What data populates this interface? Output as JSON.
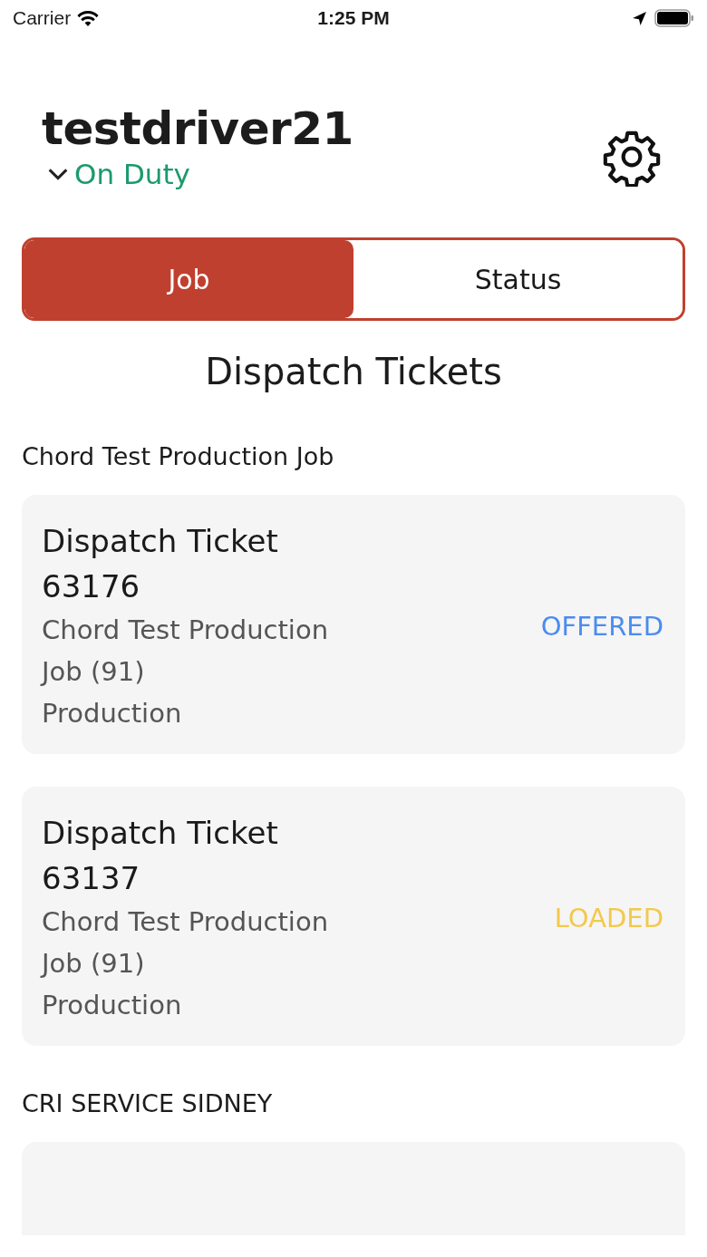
{
  "status_bar": {
    "carrier": "Carrier",
    "time": "1:25 PM"
  },
  "header": {
    "username": "testdriver21",
    "duty_status": "On Duty"
  },
  "tabs": [
    {
      "label": "Job",
      "selected": true
    },
    {
      "label": "Status",
      "selected": false
    }
  ],
  "title": "Dispatch Tickets",
  "groups": [
    {
      "name": "Chord Test Production Job",
      "tickets": [
        {
          "kind": "full",
          "title": "Dispatch Ticket 63176",
          "job": "Chord Test Production Job (91)",
          "type": "Production",
          "status": "OFFERED",
          "color": "#4a8cf0"
        },
        {
          "kind": "full",
          "title": "Dispatch Ticket 63137",
          "job": "Chord Test Production Job (91)",
          "type": "Production",
          "status": "LOADED",
          "color": "#f2c94c"
        }
      ]
    },
    {
      "name": "CRI SERVICE SIDNEY",
      "tickets": [
        {
          "kind": "cut"
        }
      ]
    }
  ]
}
